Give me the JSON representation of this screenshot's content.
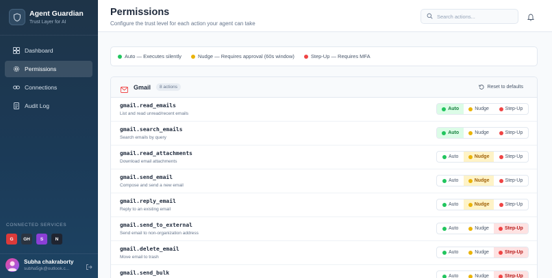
{
  "app": {
    "name": "Agent Guardian",
    "tagline": "Trust Layer for AI"
  },
  "nav": [
    {
      "label": "Dashboard",
      "icon": "dashboard-icon",
      "active": false
    },
    {
      "label": "Permissions",
      "icon": "gear-icon",
      "active": true
    },
    {
      "label": "Connections",
      "icon": "link-icon",
      "active": false
    },
    {
      "label": "Audit Log",
      "icon": "log-icon",
      "active": false
    }
  ],
  "services": {
    "title": "CONNECTED SERVICES",
    "items": [
      {
        "label": "G",
        "color": "#dc3a3a"
      },
      {
        "label": "GH",
        "color": "#2b3440"
      },
      {
        "label": "S",
        "color": "#8b3fd6"
      },
      {
        "label": "N",
        "color": "#1f2430"
      }
    ]
  },
  "user": {
    "name": "Subha chakraborty",
    "email": "subha5gk@outlook.c..."
  },
  "header": {
    "title": "Permissions",
    "subtitle": "Configure the trust level for each action your agent can take",
    "search_placeholder": "Search actions..."
  },
  "legend": [
    {
      "label": "Auto — Executes silently",
      "color": "#22c55e"
    },
    {
      "label": "Nudge — Requires approval (60s window)",
      "color": "#eab308"
    },
    {
      "label": "Step-Up — Requires MFA",
      "color": "#ef4444"
    }
  ],
  "card": {
    "service": "Gmail",
    "count": "8 actions",
    "reset_label": "Reset to defaults"
  },
  "levels": {
    "auto": "Auto",
    "nudge": "Nudge",
    "step": "Step-Up"
  },
  "actions": [
    {
      "name": "gmail.read_emails",
      "desc": "List and read unread/recent emails",
      "level": "auto"
    },
    {
      "name": "gmail.search_emails",
      "desc": "Search emails by query",
      "level": "auto"
    },
    {
      "name": "gmail.read_attachments",
      "desc": "Download email attachments",
      "level": "nudge"
    },
    {
      "name": "gmail.send_email",
      "desc": "Compose and send a new email",
      "level": "nudge"
    },
    {
      "name": "gmail.reply_email",
      "desc": "Reply to an existing email",
      "level": "nudge"
    },
    {
      "name": "gmail.send_to_external",
      "desc": "Send email to non-organization address",
      "level": "step"
    },
    {
      "name": "gmail.delete_email",
      "desc": "Move email to trash",
      "level": "step"
    },
    {
      "name": "gmail.send_bulk",
      "desc": "",
      "level": "step"
    }
  ]
}
